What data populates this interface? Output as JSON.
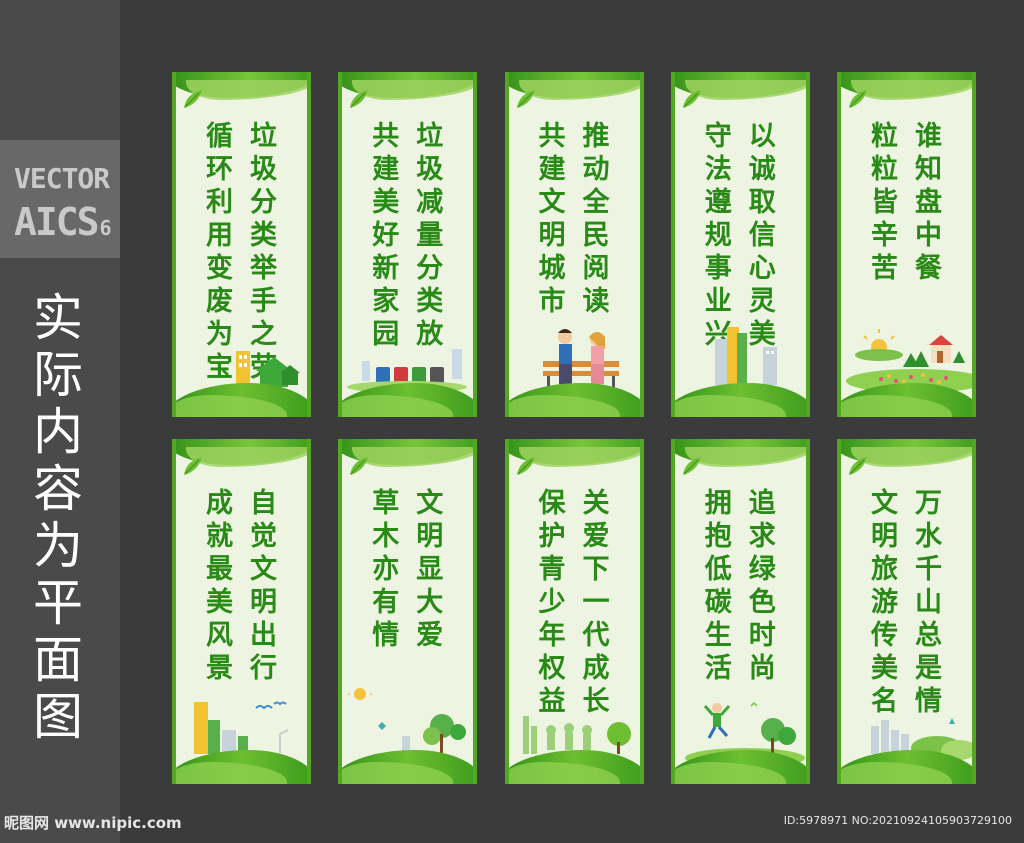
{
  "sidebar": {
    "badge_line1": "VECTOR",
    "badge_line2": "AICS",
    "badge_version": "6",
    "note": "实际内容为平面图"
  },
  "watermark": {
    "site": "昵图网 www.nipic.com",
    "id_text": "ID:5978971 NO:20210924105903729100"
  },
  "colors": {
    "frame_green": "#52a821",
    "text_green": "#2a8a17",
    "panel_bg": "#eef4e2",
    "page_bg": "#3b3b3b"
  },
  "panels": [
    {
      "lines": [
        "垃圾分类举手之劳",
        "循环利用变废为宝"
      ],
      "scene": "houses"
    },
    {
      "lines": [
        "垃圾减量分类放",
        "共建美好新家园"
      ],
      "scene": "trash-bins"
    },
    {
      "lines": [
        "推动全民阅读",
        "共建文明城市"
      ],
      "scene": "reading-bench"
    },
    {
      "lines": [
        "以诚取信心灵美",
        "守法遵规事业兴"
      ],
      "scene": "buildings"
    },
    {
      "lines": [
        "谁知盘中餐",
        "粒粒皆辛苦"
      ],
      "scene": "farm"
    },
    {
      "lines": [
        "自觉文明出行",
        "成就最美风景"
      ],
      "scene": "city-birds"
    },
    {
      "lines": [
        "文明显大爱",
        "草木亦有情"
      ],
      "scene": "trees-sun"
    },
    {
      "lines": [
        "关爱下一代成长",
        "保护青少年权益"
      ],
      "scene": "kids-running"
    },
    {
      "lines": [
        "追求绿色时尚",
        "拥抱低碳生活"
      ],
      "scene": "jumping-person"
    },
    {
      "lines": [
        "万水千山总是情",
        "文明旅游传美名"
      ],
      "scene": "skyline"
    }
  ]
}
